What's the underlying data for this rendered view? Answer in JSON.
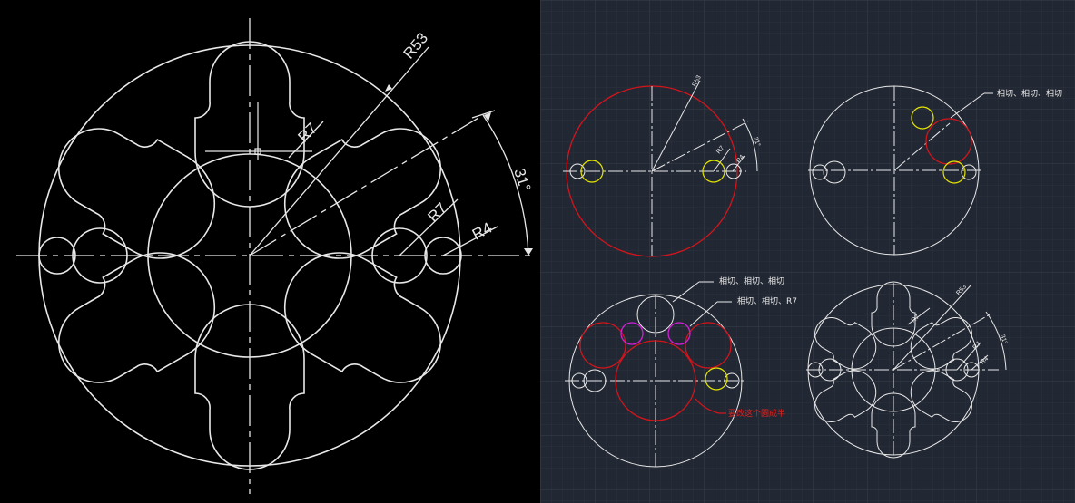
{
  "left_panel": {
    "dim_r53": "R53",
    "dim_r7_top": "R7",
    "dim_r7_side": "R7",
    "dim_r4": "R4",
    "dim_angle": "31°"
  },
  "right_panel": {
    "step1": {
      "dim_r53": "R53",
      "dim_r7": "R7",
      "dim_r4": "R4",
      "dim_angle": "31°"
    },
    "step2": {
      "note": "相切、相切、相切"
    },
    "step3": {
      "note_1": "相切、相切、相切",
      "note_2": "相切、相切、R7",
      "note_3": "要改这个圆成半"
    },
    "step4": {
      "dim_r53": "R53",
      "dim_r7_top": "R7",
      "dim_r7_side": "R7",
      "dim_r4": "R4",
      "dim_angle": "31°"
    }
  },
  "colors": {
    "left_bg": "#000000",
    "right_bg": "#222833",
    "grid_minor": "#2b323d",
    "grid_major": "#343d4a",
    "line": "#e8e8e8",
    "red": "#d4141b",
    "yellow": "#e6e600",
    "magenta": "#d21fd6",
    "note_red": "#e0201e"
  }
}
